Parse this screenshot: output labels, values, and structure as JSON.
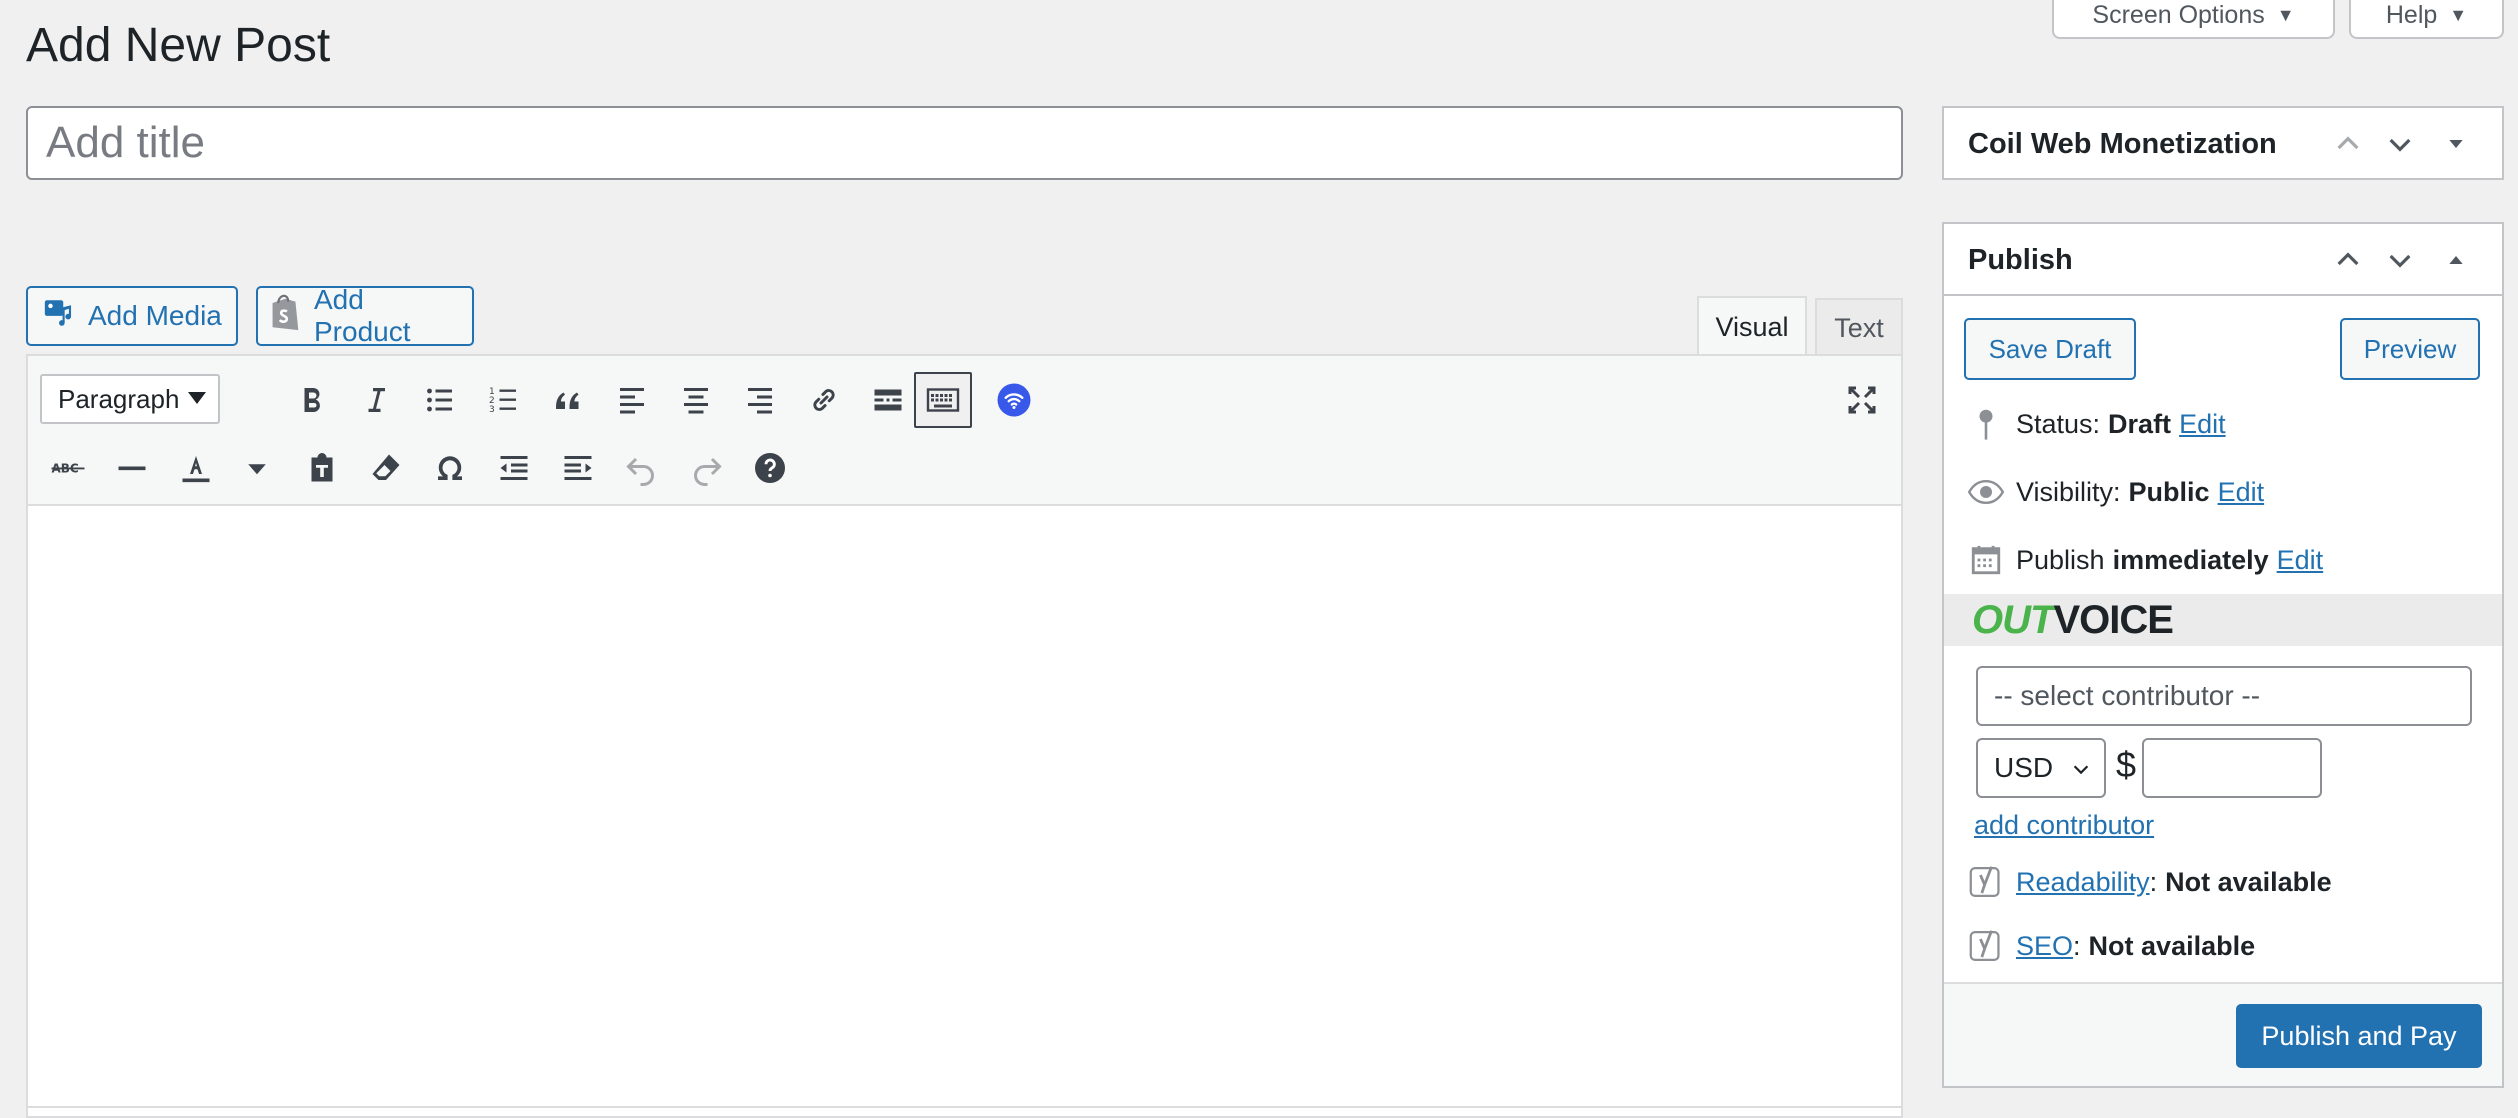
{
  "page": {
    "title": "Add New Post"
  },
  "screen_meta": {
    "screen_options_label": "Screen Options",
    "help_label": "Help"
  },
  "title_field": {
    "placeholder": "Add title",
    "value": ""
  },
  "media_buttons": {
    "add_media": "Add Media",
    "add_product": "Add Product"
  },
  "editor": {
    "tabs": {
      "visual": "Visual",
      "text": "Text"
    },
    "active_tab": "Visual",
    "format_select": "Paragraph",
    "toolbar_row1": [
      "bold",
      "italic",
      "bulleted-list",
      "numbered-list",
      "blockquote",
      "align-left",
      "align-center",
      "align-right",
      "insert-link",
      "read-more",
      "toolbar-toggle",
      "wifi"
    ],
    "toolbar_row2": [
      "strikethrough",
      "horizontal-line",
      "text-color",
      "paste-as-text",
      "clear-formatting",
      "special-character",
      "outdent",
      "indent",
      "undo",
      "redo",
      "keyboard-shortcuts"
    ]
  },
  "sidebar": {
    "coil": {
      "title": "Coil Web Monetization"
    },
    "publish": {
      "title": "Publish",
      "save_draft": "Save Draft",
      "preview": "Preview",
      "status": {
        "label": "Status:",
        "value": "Draft",
        "edit": "Edit"
      },
      "visibility": {
        "label": "Visibility:",
        "value": "Public",
        "edit": "Edit"
      },
      "schedule": {
        "label": "Publish",
        "value": "immediately",
        "edit": "Edit"
      },
      "outvoice": {
        "logo_out": "OUT",
        "logo_voice": "VOICE",
        "contributor_placeholder": "-- select contributor --",
        "currency": "USD",
        "currency_symbol": "$",
        "amount": "",
        "add_contributor": "add contributor"
      },
      "readability": {
        "link": "Readability",
        "value": "Not available"
      },
      "seo": {
        "link": "SEO",
        "value": "Not available"
      },
      "publish_button": "Publish and Pay"
    }
  },
  "colors": {
    "accent": "#2271b1",
    "background": "#f0f0f1",
    "outvoice_green": "#4bb34b",
    "wifi_blue": "#3858e9"
  }
}
